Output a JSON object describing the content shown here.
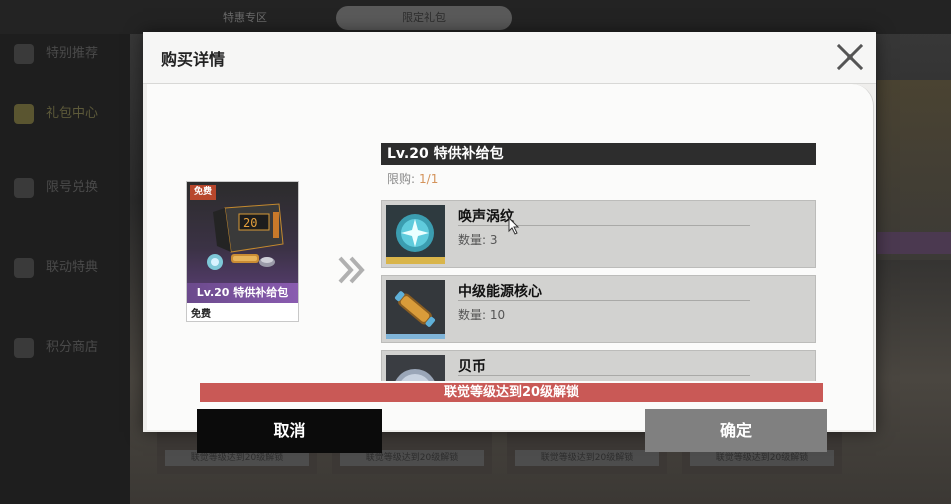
{
  "background": {
    "tabs": [
      "特惠专区",
      "限定礼包"
    ],
    "sidebar_items": [
      "特别推荐",
      "礼包中心",
      "限号兑换",
      "联动特典",
      "积分商店"
    ],
    "card_footer": "联觉等级达到20级解锁"
  },
  "modal": {
    "title": "购买详情",
    "product": {
      "badge": "免费",
      "name": "Lv.20 特供补给包",
      "price": "免费",
      "icon_text": "20"
    },
    "detail": {
      "title": "Lv.20 特供补给包",
      "limit_label": "限购:",
      "limit_value": "1/1"
    },
    "rewards": [
      {
        "name": "唤声涡纹",
        "qty": "数量: 3",
        "icon": "vortex-orb-icon"
      },
      {
        "name": "中级能源核心",
        "qty": "数量: 10",
        "icon": "energy-core-icon"
      },
      {
        "name": "贝币",
        "qty": "",
        "icon": "coin-icon"
      }
    ],
    "unlock_banner": "联觉等级达到20级解锁",
    "cancel_label": "取消",
    "confirm_label": "确定"
  },
  "colors": {
    "accent_orange": "#d4935a",
    "banner_red": "#c95956",
    "cancel_black": "#0b0b0b",
    "confirm_gray": "#808080",
    "purple": "#6b4a8c"
  }
}
